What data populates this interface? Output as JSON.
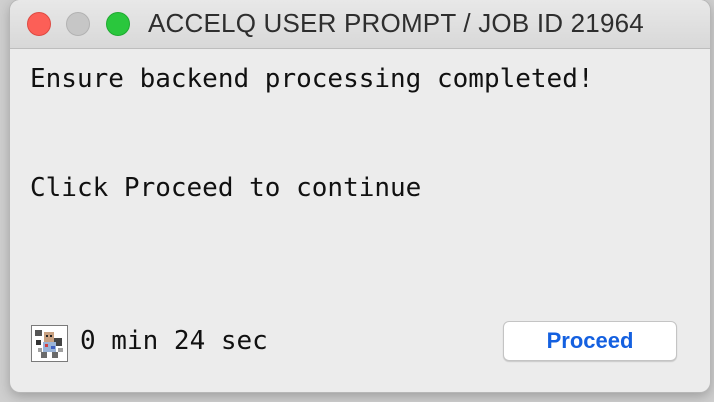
{
  "window": {
    "title": "ACCELQ USER PROMPT / JOB ID 21964"
  },
  "message": {
    "line1": "Ensure backend processing completed!",
    "line2": "Click Proceed to continue"
  },
  "footer": {
    "timer_icon": "robot-timer-icon",
    "timer_text": "0 min 24 sec",
    "proceed_label": "Proceed"
  },
  "colors": {
    "close": "#fc5f57",
    "minimize": "#c6c6c6",
    "maximize": "#2ac73d",
    "button_text": "#1460e0"
  }
}
